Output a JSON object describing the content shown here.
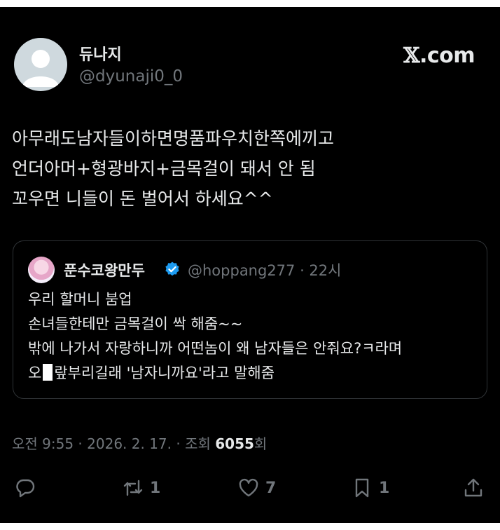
{
  "brand": {
    "x_glyph": "𝕏",
    "dot_com": ".com"
  },
  "author": {
    "display_name": "듀나지",
    "handle": "@dyunaji0_0"
  },
  "tweet": {
    "lines": [
      "아무래도남자들이하면명품파우치한쪽에끼고",
      "언더아머+형광바지+금목걸이 돼서 안 됨",
      "꼬우면 니들이 돈 벌어서 하세요^^"
    ]
  },
  "quote": {
    "display_name": "푼수코왕만두",
    "handle_time": "@hoppang277 · 22시",
    "lines": [
      "우리 할머니 붐업",
      "손녀들한테만 금목걸이 싹 해줌~~",
      "밖에 나가서 자랑하니까 어떤놈이 왜 남자들은 안줘요?ㅋ라며"
    ],
    "last_line_prefix": "오",
    "last_line_suffix": "랖부리길래 '남자니까요'라고 말해줌"
  },
  "meta": {
    "timestamp": "오전 9:55 · 2026. 2. 17. · 조회 ",
    "views": "6055",
    "views_suffix": "회"
  },
  "actions": {
    "reply_icon": "speech-bubble-icon",
    "retweet_icon": "retweet-icon",
    "retweet_count": "1",
    "like_icon": "heart-icon",
    "like_count": "7",
    "bookmark_icon": "bookmark-icon",
    "bookmark_count": "1",
    "share_icon": "share-icon"
  },
  "colors": {
    "background": "#000000",
    "text": "#e7e9ea",
    "muted": "#71767b",
    "verified": "#1d9bf0"
  }
}
